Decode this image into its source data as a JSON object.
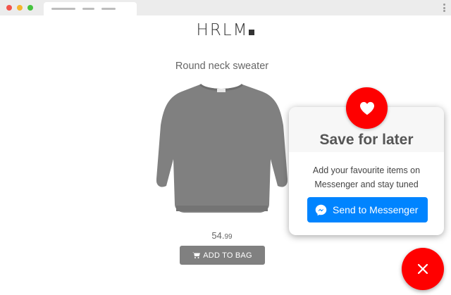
{
  "logo": {
    "text": "HRLM"
  },
  "product": {
    "title": "Round neck sweater",
    "price_main": "54.",
    "price_cents": "99",
    "add_to_bag_label": "ADD TO BAG",
    "image_color": "#808080"
  },
  "popup": {
    "title": "Save for later",
    "text": "Add your favourite items on Messenger and stay tuned",
    "button_label": "Send to Messenger",
    "button_color": "#0084ff",
    "badge_icon": "heart-icon",
    "badge_color": "#fe0000"
  },
  "fab": {
    "icon": "close-icon",
    "color": "#ff0000"
  },
  "browser": {
    "menu_icon": "kebab-menu-icon"
  }
}
